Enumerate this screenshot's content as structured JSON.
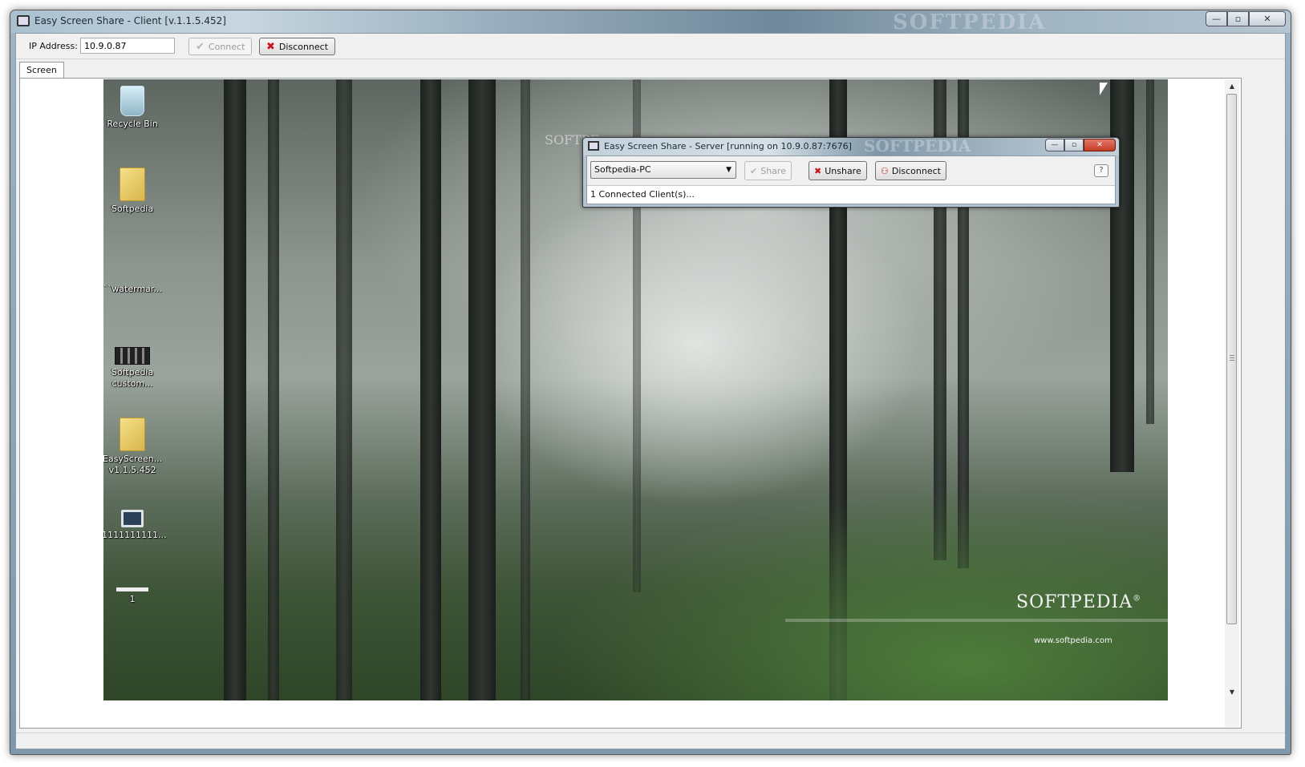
{
  "window": {
    "title": "Easy Screen Share - Client [v.1.1.5.452]",
    "titlebar_watermark": "SOFTPEDIA",
    "controls": {
      "minimize": "—",
      "maximize": "▫",
      "close": "✕"
    }
  },
  "toolbar": {
    "ip_label": "IP Address:",
    "ip_value": "10.9.0.87",
    "connect_label": "Connect",
    "disconnect_label": "Disconnect",
    "connect_icon": "check-icon",
    "disconnect_icon": "red-x-icon"
  },
  "tabs": [
    {
      "label": "Screen",
      "active": true
    }
  ],
  "desktop": {
    "icons": [
      {
        "label": "Recycle Bin",
        "icon": "recycle-bin-icon"
      },
      {
        "label": "Softpedia",
        "icon": "folder-icon"
      },
      {
        "label": "``watermar...",
        "icon": "file-icon"
      },
      {
        "label": "Softpedia custom...",
        "icon": "film-icon"
      },
      {
        "label": "EasyScreen... v1.1.5.452",
        "icon": "folder-icon"
      },
      {
        "label": "1111111111...",
        "icon": "computer-icon"
      },
      {
        "label": "1",
        "icon": "shortcut-icon"
      }
    ],
    "watermark": "SOFTPEDIA",
    "watermark_mark": "®",
    "watermark_url": "www.softpedia.com",
    "overlay_text": "SOFTPE"
  },
  "server_window": {
    "title": "Easy Screen Share - Server [running on 10.9.0.87:7676]",
    "titlebar_watermark": "SOFTPEDIA",
    "controls": {
      "minimize": "—",
      "maximize": "▫",
      "close": "✕"
    },
    "selected_client": "Softpedia-PC",
    "share_label": "Share",
    "unshare_label": "Unshare",
    "disconnect_label": "Disconnect",
    "help_label": "?",
    "status": "1 Connected Client(s)..."
  },
  "scrollbar": {
    "up": "▲",
    "down": "▼"
  }
}
